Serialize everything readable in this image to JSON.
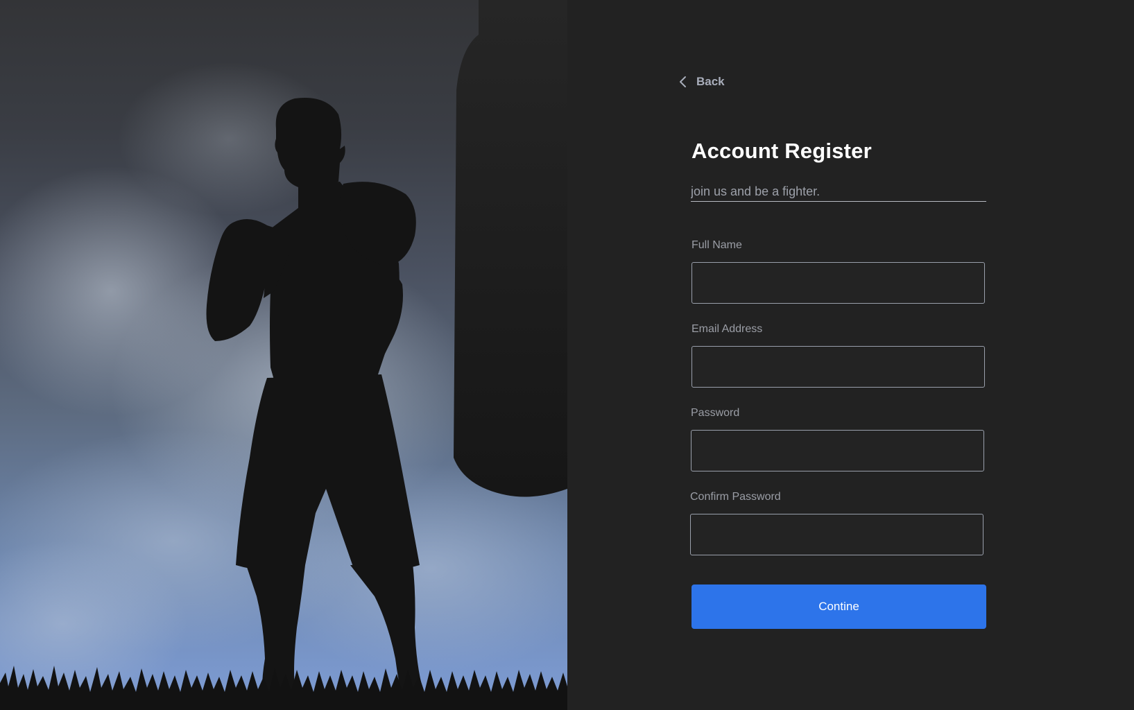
{
  "back": {
    "label": "Back",
    "icon": "chevron-left-icon"
  },
  "header": {
    "title": "Account Register",
    "subtitle_placeholder": "join us and be a fighter."
  },
  "form": {
    "full_name": {
      "label": "Full Name",
      "value": ""
    },
    "email": {
      "label": "Email Address",
      "value": ""
    },
    "password": {
      "label": "Password",
      "value": ""
    },
    "confirm_password": {
      "label": "Confirm Password",
      "value": ""
    },
    "submit_label": "Contine"
  },
  "colors": {
    "background": "#222222",
    "accent": "#2d74ea",
    "title": "#ffffff",
    "muted_text": "#9b9ea6"
  }
}
